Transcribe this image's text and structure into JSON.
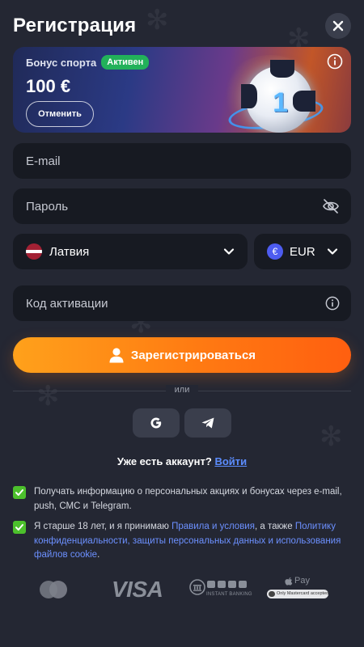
{
  "header": {
    "title": "Регистрация"
  },
  "bonus": {
    "label": "Бонус спорта",
    "status": "Активен",
    "amount": "100 €",
    "cancel_label": "Отменить",
    "ball_number": "1"
  },
  "form": {
    "email_placeholder": "E-mail",
    "password_placeholder": "Пароль",
    "country": "Латвия",
    "currency": "EUR",
    "currency_symbol": "€",
    "activation_placeholder": "Код активации"
  },
  "register_label": "Зарегистрироваться",
  "divider_text": "или",
  "login_prompt": {
    "question": "Уже есть аккаунт?",
    "link": "Войти"
  },
  "consents": [
    {
      "checked": true,
      "text": "Получать информацию о персональных акциях и бонусах через e-mail, push, СМС и Telegram."
    },
    {
      "checked": true,
      "text_1": "Я старше 18 лет, и я принимаю ",
      "link_1": "Правила и условия",
      "text_2": ", а также ",
      "link_2": "Политику конфиденциальности, защиты персональных данных и использования файлов cookie",
      "text_3": "."
    }
  ],
  "payments": {
    "visa": "VISA",
    "instant_banking": "INSTANT BANKING",
    "apple_pay": "Pay",
    "apple_pay_note": "Only Mastercard accepted"
  },
  "colors": {
    "background": "#242733",
    "accent_orange": "#ff7a12",
    "active_green": "#22b15a",
    "link_blue": "#5c8dff"
  }
}
